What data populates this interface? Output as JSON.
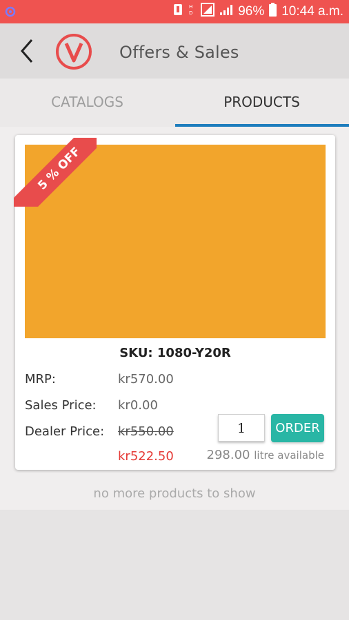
{
  "status_bar": {
    "left_icon": "settings-icon",
    "battery_percent": "96%",
    "time": "10:44 a.m."
  },
  "header": {
    "title": "Offers & Sales",
    "back_icon": "chevron-left-icon",
    "logo_letter": "V"
  },
  "tabs": [
    {
      "label": "CATALOGS",
      "active": false
    },
    {
      "label": "PRODUCTS",
      "active": true
    }
  ],
  "colors": {
    "status_bar": "#ef5350",
    "accent": "#1e7dbd",
    "product_swatch": "#f2a52c",
    "ribbon": "#e84c4c",
    "order_button": "#29b6a5",
    "discount_price": "#e53935"
  },
  "product": {
    "discount_badge": "5 % OFF",
    "sku": "SKU: 1080-Y20R",
    "mrp_label": "MRP:",
    "mrp_value": "kr570.00",
    "sales_label": "Sales Price:",
    "sales_value": "kr0.00",
    "dealer_label": "Dealer Price:",
    "dealer_value_original": "kr550.00",
    "dealer_value_discounted": "kr522.50",
    "quantity": "1",
    "order_label": "ORDER",
    "available_amount": "298.00",
    "available_unit": "litre available"
  },
  "footer_note": "no more products to show"
}
